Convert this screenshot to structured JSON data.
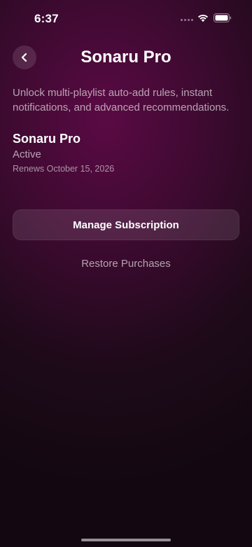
{
  "status_bar": {
    "time": "6:37"
  },
  "header": {
    "title": "Sonaru Pro",
    "back_icon": "chevron-left-icon"
  },
  "description": "Unlock multi-playlist auto-add rules, instant notifications, and advanced recommendations.",
  "plan": {
    "name": "Sonaru Pro",
    "status": "Active",
    "renewal": "Renews October 15, 2026"
  },
  "actions": {
    "manage_label": "Manage Subscription",
    "restore_label": "Restore Purchases"
  },
  "colors": {
    "background_accent": "#5a0a44",
    "background_dark": "#130811",
    "text_primary": "#ffffff"
  }
}
